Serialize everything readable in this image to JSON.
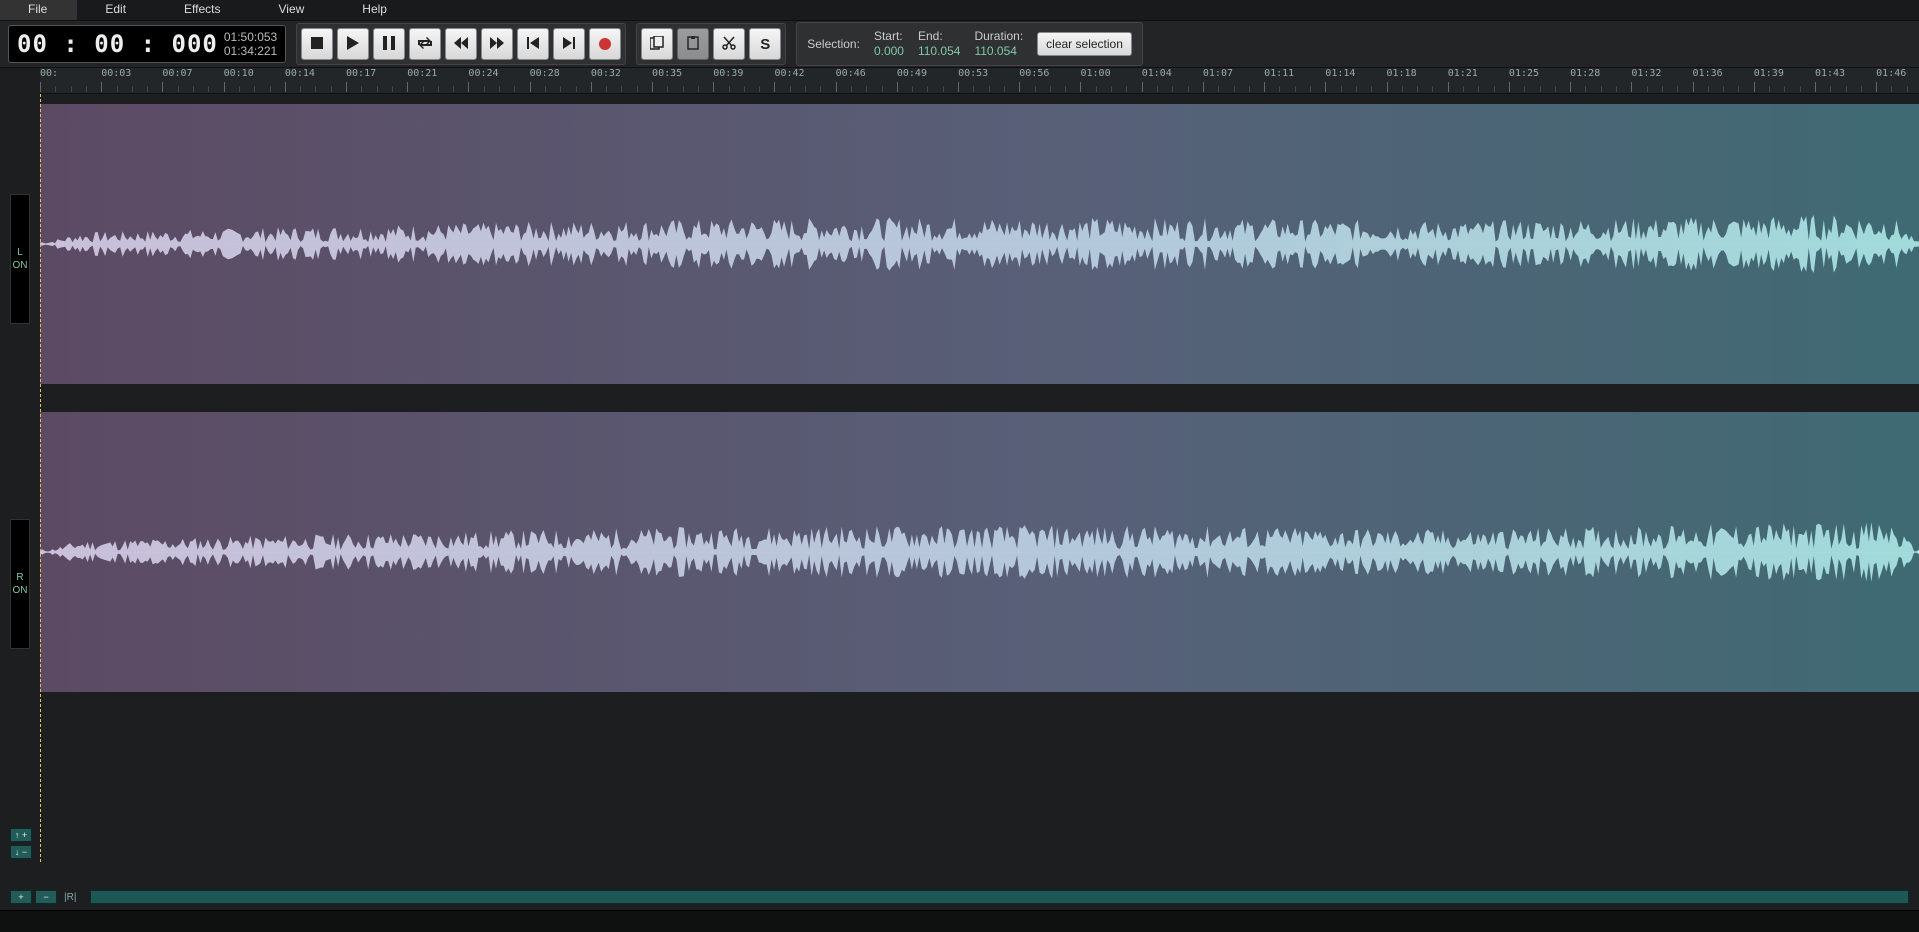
{
  "menu": {
    "file": "File",
    "edit": "Edit",
    "effects": "Effects",
    "view": "View",
    "help": "Help"
  },
  "time": {
    "current": "00 : 00 : 000",
    "total": "01:50:053",
    "length": "01:34:221"
  },
  "selection": {
    "label": "Selection:",
    "start_k": "Start:",
    "start_v": "0.000",
    "end_k": "End:",
    "end_v": "110.054",
    "dur_k": "Duration:",
    "dur_v": "110.054",
    "clear": "clear selection"
  },
  "buttons": {
    "script": "S"
  },
  "channels": {
    "l": "L",
    "r": "R",
    "on": "ON"
  },
  "ruler_ticks": [
    "00:",
    "00:03",
    "00:07",
    "00:10",
    "00:14",
    "00:17",
    "00:21",
    "00:24",
    "00:28",
    "00:32",
    "00:35",
    "00:39",
    "00:42",
    "00:46",
    "00:49",
    "00:53",
    "00:56",
    "01:00",
    "01:04",
    "01:07",
    "01:11",
    "01:14",
    "01:18",
    "01:21",
    "01:25",
    "01:28",
    "01:32",
    "01:36",
    "01:39",
    "01:43",
    "01:46"
  ],
  "zoom": {
    "vplus": "↑ +",
    "vminus": "↓ −",
    "plus": "+",
    "minus": "−",
    "reset": "|R|"
  }
}
